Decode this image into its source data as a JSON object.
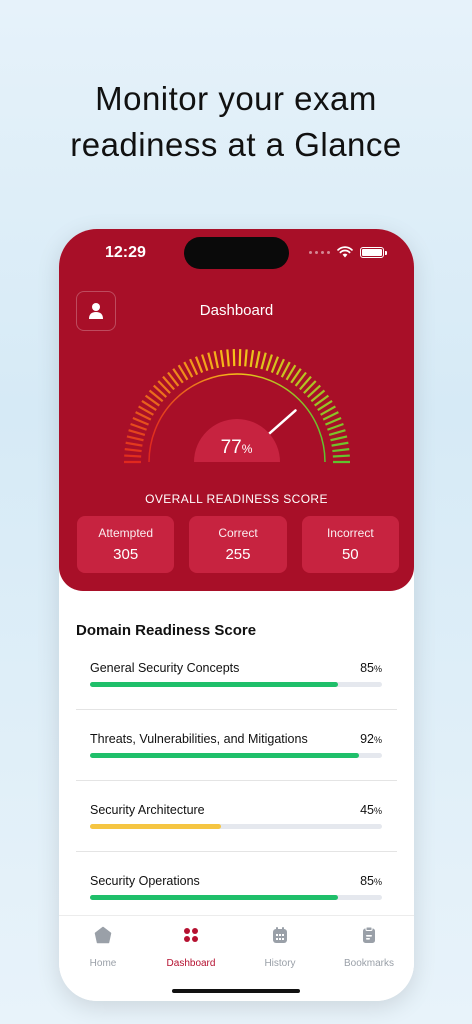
{
  "promo": {
    "line1": "Monitor your exam",
    "line2": "readiness at a Glance"
  },
  "status": {
    "time": "12:29"
  },
  "header": {
    "title": "Dashboard"
  },
  "gauge": {
    "value": 77,
    "value_text": "77",
    "unit": "%",
    "label": "OVERALL READINESS SCORE"
  },
  "stats": [
    {
      "label": "Attempted",
      "value": "305"
    },
    {
      "label": "Correct",
      "value": "255"
    },
    {
      "label": "Incorrect",
      "value": "50"
    }
  ],
  "domains": {
    "title": "Domain Readiness Score",
    "items": [
      {
        "name": "General Security Concepts",
        "value": 85,
        "value_text": "85",
        "unit": "%",
        "color": "#1fbf6a"
      },
      {
        "name": "Threats, Vulnerabilities, and Mitigations",
        "value": 92,
        "value_text": "92",
        "unit": "%",
        "color": "#1fbf6a"
      },
      {
        "name": "Security Architecture",
        "value": 45,
        "value_text": "45",
        "unit": "%",
        "color": "#f5c542"
      },
      {
        "name": "Security Operations",
        "value": 85,
        "value_text": "85",
        "unit": "%",
        "color": "#1fbf6a"
      }
    ]
  },
  "tabs": [
    {
      "label": "Home",
      "icon": "home-icon",
      "active": false
    },
    {
      "label": "Dashboard",
      "icon": "dashboard-grid-icon",
      "active": true
    },
    {
      "label": "History",
      "icon": "history-icon",
      "active": false
    },
    {
      "label": "Bookmarks",
      "icon": "bookmarks-icon",
      "active": false
    }
  ],
  "colors": {
    "brand": "#a80f28",
    "card": "#c72340",
    "active_tab": "#b51130",
    "gauge_low": "#e0281e",
    "gauge_mid": "#f7c21a",
    "gauge_high": "#5fc22e"
  }
}
